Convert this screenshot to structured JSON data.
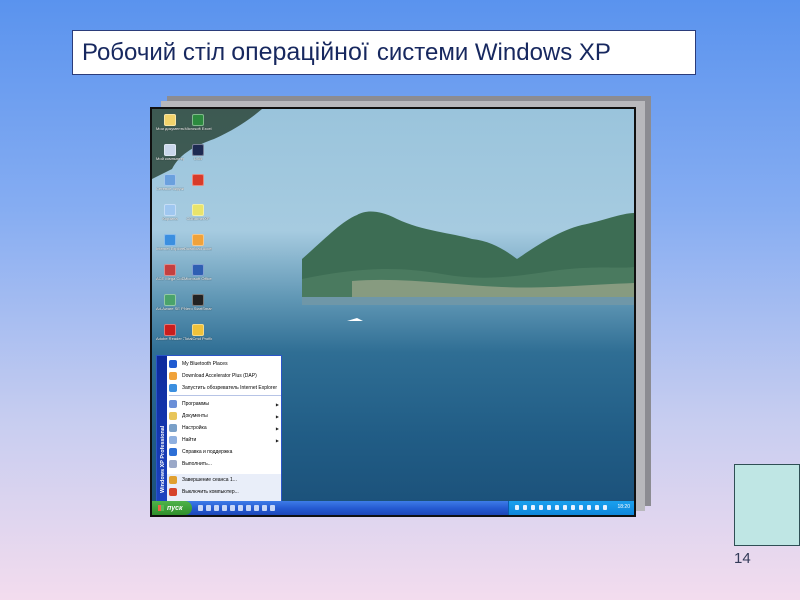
{
  "slide": {
    "title_part1": "Робочий стіл",
    "title_part2": "операційної",
    "title_part3": "системи Windows XP",
    "page_number": "14"
  },
  "colors": {
    "title_text": "#17285f",
    "taskbar": "#2459d0",
    "start_button": "#2f8f2b",
    "side_box": "#bfe6e4"
  },
  "screenshot": {
    "desktop_icons": [
      {
        "label": "Мои документы",
        "icon": "folder-icon",
        "color": "#f2d36b"
      },
      {
        "label": "Microsoft Excel",
        "icon": "excel-icon",
        "color": "#2c8a3f"
      },
      {
        "label": "Мой компьютер",
        "icon": "computer-icon",
        "color": "#c9d6ea"
      },
      {
        "label": "USB",
        "icon": "usb-icon",
        "color": "#1e2a52"
      },
      {
        "label": "Сетевое окружение",
        "icon": "network-icon",
        "color": "#6aa0de"
      },
      {
        "label": "",
        "icon": "app-icon",
        "color": "#d83b2a"
      },
      {
        "label": "Корзина",
        "icon": "recycle-bin-icon",
        "color": "#9fc7f0"
      },
      {
        "label": "CDBurnerXP",
        "icon": "disc-icon",
        "color": "#e9e46b"
      },
      {
        "label": "Internet Explorer",
        "icon": "ie-icon",
        "color": "#3b8fe0"
      },
      {
        "label": "Download Accelerator",
        "icon": "download-icon",
        "color": "#f0a23a"
      },
      {
        "label": "ACE Mega CoDecS",
        "icon": "codec-icon",
        "color": "#c44040"
      },
      {
        "label": "Microsoft Office Wo...",
        "icon": "word-icon",
        "color": "#2f5fb3"
      },
      {
        "label": "Ad-Aware SE Perso...",
        "icon": "shield-icon",
        "color": "#4aa36b"
      },
      {
        "label": "Nero StartSmart",
        "icon": "nero-icon",
        "color": "#222222"
      },
      {
        "label": "Adobe Reader 7.0",
        "icon": "pdf-icon",
        "color": "#c91d1d"
      },
      {
        "label": "TotalCmd Profiles",
        "icon": "totalcmd-icon",
        "color": "#f0c23a"
      }
    ],
    "start_menu": {
      "side_label": "Windows XP Professional",
      "pinned": [
        {
          "label": "My Bluetooth Places",
          "icon": "bluetooth-icon",
          "color": "#1f5bd1"
        },
        {
          "label": "Download Accelerator Plus (DAP)",
          "icon": "download-icon",
          "color": "#f0a23a"
        },
        {
          "label": "Запустить обозреватель Internet Explorer",
          "icon": "ie-icon",
          "color": "#3b8fe0"
        }
      ],
      "items": [
        {
          "label": "Программы",
          "icon": "programs-icon",
          "color": "#6a8fd8",
          "arrow": "▶"
        },
        {
          "label": "Документы",
          "icon": "documents-icon",
          "color": "#e8c55a",
          "arrow": "▶"
        },
        {
          "label": "Настройка",
          "icon": "settings-icon",
          "color": "#7aa0c8",
          "arrow": "▶"
        },
        {
          "label": "Найти",
          "icon": "search-icon",
          "color": "#8fb0e0",
          "arrow": "▶"
        },
        {
          "label": "Справка и поддержка",
          "icon": "help-icon",
          "color": "#2d6fd6",
          "arrow": ""
        },
        {
          "label": "Выполнить...",
          "icon": "run-icon",
          "color": "#9aa8c8",
          "arrow": ""
        }
      ],
      "logoff_label": "Завершение сеанса 1...",
      "shutdown_label": "Выключить компьютер..."
    },
    "taskbar": {
      "start_label": "пуск",
      "clock": "18:20"
    }
  }
}
